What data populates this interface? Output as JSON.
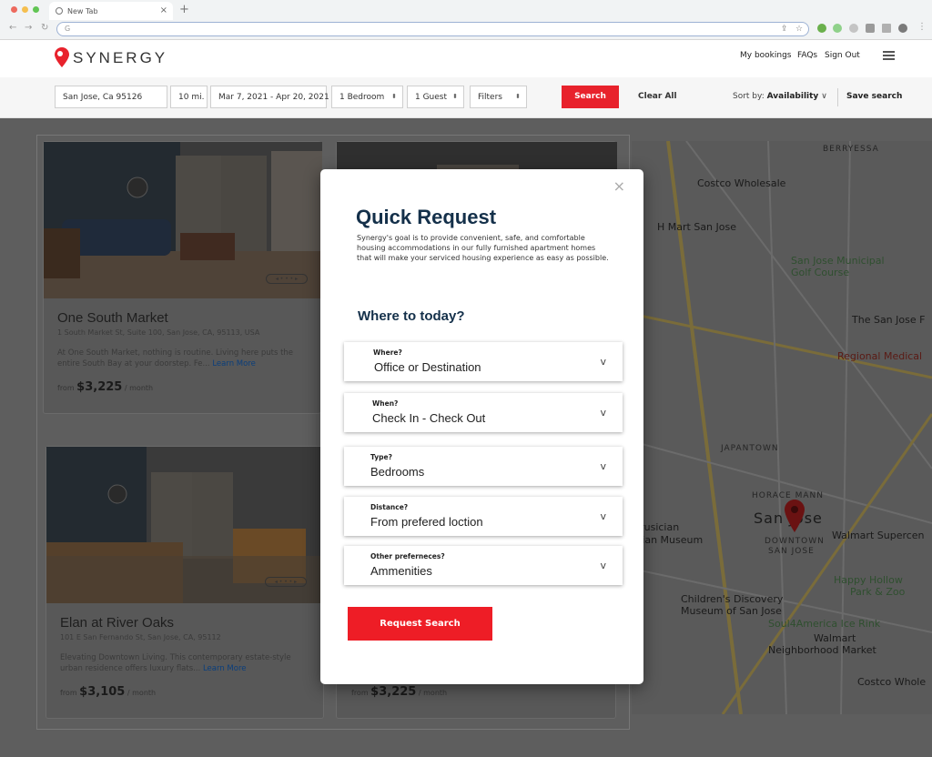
{
  "browser": {
    "tab_title": "New Tab",
    "new_tab_symbol": "+",
    "omnibox_text": "G",
    "colors": {
      "red": "#ed6a5e",
      "yellow": "#f5bf4f",
      "green": "#61c554"
    }
  },
  "header": {
    "logo_text": "SYNERGY",
    "links": [
      "My bookings",
      "FAQs",
      "Sign Out"
    ]
  },
  "searchbar": {
    "location": "San Jose, Ca 95126",
    "radius": "10 mi.",
    "dates": "Mar 7, 2021 - Apr 20, 2021",
    "bedrooms": "1 Bedroom",
    "guests": "1 Guest",
    "filters": "Filters",
    "search_label": "Search",
    "clear_label": "Clear All",
    "sort_prefix": "Sort by:",
    "sort_value": "Availability",
    "save_label": "Save search"
  },
  "listings": [
    {
      "name": "One South Market",
      "address": "1 South Market St, Suite 100, San Jose, CA, 95113, USA",
      "description": "At One South Market, nothing is routine. Living here puts the entire South Bay at your doorstep. Fe...",
      "learn_more": "Learn More",
      "price_prefix": "from",
      "price": "$3,225",
      "price_suffix": "/ month"
    },
    {
      "name": "Elan at River Oaks",
      "address": "101 E San Fernando St, San Jose, CA, 95112",
      "description": "Elevating Downtown Living. This contemporary estate-style urban residence offers luxury flats...",
      "learn_more": "Learn More",
      "price_prefix": "from",
      "price": "$3,105",
      "price_suffix": "/ month"
    },
    {
      "price_prefix": "from",
      "price": "$3,225",
      "price_suffix": "/ month"
    }
  ],
  "map": {
    "labels": [
      "BERRYESSA",
      "Costco Wholesale",
      "H Mart San Jose",
      "San Jose Municipal",
      "Golf Course",
      "The San Jose F",
      "Regional Medical",
      "JAPANTOWN",
      "HORACE MANN",
      "San Jose",
      "Walmart Supercen",
      "DOWNTOWN",
      "SAN JOSE",
      "icrusician",
      "ptian Museum",
      "Happy Hollow",
      "Park & Zoo",
      "Children's Discovery",
      "Museum of San Jose",
      "Soul4America Ice Rink",
      "Walmart",
      "Neighborhood Market",
      "Costco Whole"
    ]
  },
  "modal": {
    "title": "Quick Request",
    "description": "Synergy's goal is to provide convenient, safe, and comfortable housing accommodations in our fully furnished apartment homes that will make your serviced housing experience as easy as possible.",
    "subtitle": "Where to today?",
    "close_symbol": "×",
    "caret": "v",
    "fields": [
      {
        "label": "Where?",
        "value": "Office or Destination"
      },
      {
        "label": "When?",
        "value": "Check In - Check Out"
      },
      {
        "label": "Type?",
        "value": "Bedrooms"
      },
      {
        "label": "Distance?",
        "value": "From prefered loction"
      },
      {
        "label": "Other preferneces?",
        "value": "Ammenities"
      }
    ],
    "submit_label": "Request Search"
  },
  "colors": {
    "accent": "#ee1d26",
    "heading": "#14304a"
  }
}
